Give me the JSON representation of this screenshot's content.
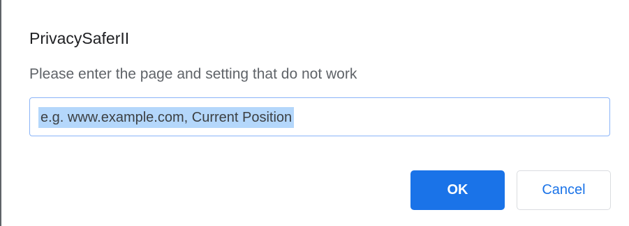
{
  "dialog": {
    "title": "PrivacySaferII",
    "message": "Please enter the page and setting that do not work",
    "input": {
      "value": "e.g. www.example.com, Current Position",
      "selected": true
    },
    "ok_label": "OK",
    "cancel_label": "Cancel"
  },
  "colors": {
    "accent": "#1a73e8",
    "input_border": "#8ab4f8",
    "selection": "#b4d7fb",
    "title_text": "#202124",
    "message_text": "#5f6368"
  }
}
